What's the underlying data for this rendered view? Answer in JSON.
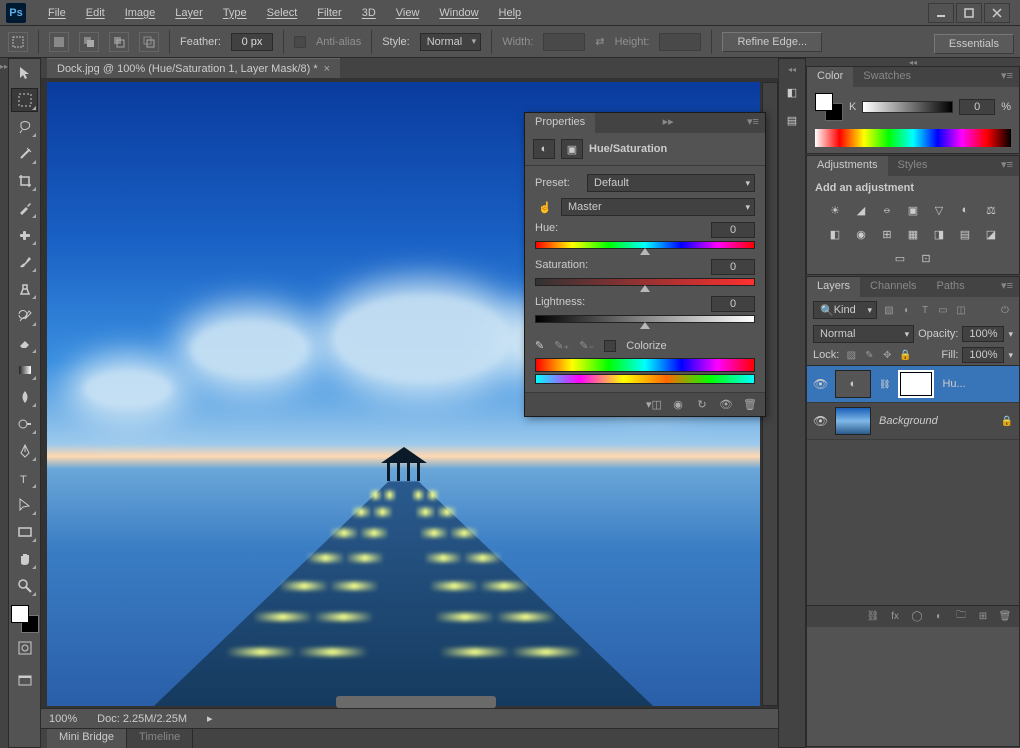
{
  "menubar": [
    "File",
    "Edit",
    "Image",
    "Layer",
    "Type",
    "Select",
    "Filter",
    "3D",
    "View",
    "Window",
    "Help"
  ],
  "optionsbar": {
    "feather_label": "Feather:",
    "feather_value": "0 px",
    "antialias": "Anti-alias",
    "style_label": "Style:",
    "style_value": "Normal",
    "width_label": "Width:",
    "height_label": "Height:",
    "refine": "Refine Edge...",
    "essentials": "Essentials"
  },
  "document": {
    "tab": "Dock.jpg @ 100% (Hue/Saturation 1, Layer Mask/8) *",
    "zoom": "100%",
    "doc_size": "Doc: 2.25M/2.25M"
  },
  "footer_tabs": [
    "Mini Bridge",
    "Timeline"
  ],
  "color_panel": {
    "tabs": [
      "Color",
      "Swatches"
    ],
    "k_label": "K",
    "k_value": "0",
    "pct": "%"
  },
  "adjustments_panel": {
    "tabs": [
      "Adjustments",
      "Styles"
    ],
    "label": "Add an adjustment"
  },
  "layers_panel": {
    "tabs": [
      "Layers",
      "Channels",
      "Paths"
    ],
    "kind": "Kind",
    "blend": "Normal",
    "opacity_label": "Opacity:",
    "opacity_value": "100%",
    "lock_label": "Lock:",
    "fill_label": "Fill:",
    "fill_value": "100%",
    "layers": [
      {
        "name": "Hu...",
        "type": "adjustment",
        "selected": true
      },
      {
        "name": "Background",
        "type": "image",
        "locked": true
      }
    ]
  },
  "properties_panel": {
    "title": "Properties",
    "adj_name": "Hue/Saturation",
    "preset_label": "Preset:",
    "preset_value": "Default",
    "channel_value": "Master",
    "hue_label": "Hue:",
    "hue_value": "0",
    "sat_label": "Saturation:",
    "sat_value": "0",
    "light_label": "Lightness:",
    "light_value": "0",
    "colorize": "Colorize"
  }
}
